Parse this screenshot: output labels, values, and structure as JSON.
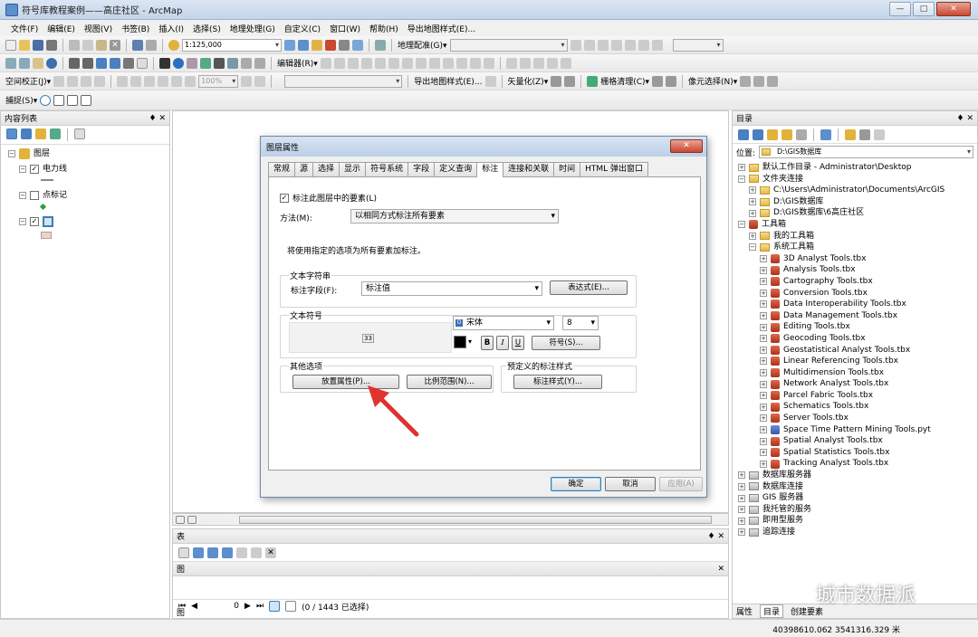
{
  "window": {
    "title": "符号库教程案例——高庄社区 - ArcMap",
    "controls": [
      "—",
      "□",
      "✕"
    ]
  },
  "menu": [
    "文件(F)",
    "编辑(E)",
    "视图(V)",
    "书签(B)",
    "插入(I)",
    "选择(S)",
    "地理处理(G)",
    "自定义(C)",
    "窗口(W)",
    "帮助(H)",
    "导出地图样式(E)..."
  ],
  "toolbar1": {
    "scale": "1:125,000",
    "georef_label": "地理配准(G)▾"
  },
  "toolbar2": {
    "editor": "编辑器(R)▾"
  },
  "toolbar3": {
    "spatial_adjust": "空间校正(J)▾",
    "zoom": "100%",
    "export": "导出地图样式(E)...",
    "vectorize": "矢量化(Z)▾",
    "raster_cleanup": "栅格清理(C)▾",
    "cell_select": "像元选择(N)▾"
  },
  "snapping": {
    "label": "捕捉(S)▾"
  },
  "toc": {
    "title": "内容列表",
    "title_buttons": "♦ ✕",
    "layers_label": "图层",
    "items": [
      {
        "label": "电力线",
        "checked": true
      },
      {
        "label": "点标记",
        "checked": false
      },
      {
        "label": "",
        "checked": true
      }
    ]
  },
  "catalog": {
    "title": "目录",
    "title_buttons": "♦ ✕",
    "location_label": "位置:",
    "location_value": "D:\\GIS数据库",
    "tree": [
      {
        "label": "默认工作目录 - Administrator\\Desktop",
        "level": 0,
        "type": "folder"
      },
      {
        "label": "文件夹连接",
        "level": 0,
        "type": "folder",
        "expanded": true
      },
      {
        "label": "C:\\Users\\Administrator\\Documents\\ArcGIS",
        "level": 1,
        "type": "folder"
      },
      {
        "label": "D:\\GIS数据库",
        "level": 1,
        "type": "folder"
      },
      {
        "label": "D:\\GIS数据库\\6高庄社区",
        "level": 1,
        "type": "folder"
      },
      {
        "label": "工具箱",
        "level": 0,
        "type": "tbx",
        "expanded": true
      },
      {
        "label": "我的工具箱",
        "level": 1,
        "type": "folder"
      },
      {
        "label": "系统工具箱",
        "level": 1,
        "type": "folder",
        "expanded": true
      },
      {
        "label": "3D Analyst Tools.tbx",
        "level": 2,
        "type": "tbx"
      },
      {
        "label": "Analysis Tools.tbx",
        "level": 2,
        "type": "tbx"
      },
      {
        "label": "Cartography Tools.tbx",
        "level": 2,
        "type": "tbx"
      },
      {
        "label": "Conversion Tools.tbx",
        "level": 2,
        "type": "tbx"
      },
      {
        "label": "Data Interoperability Tools.tbx",
        "level": 2,
        "type": "tbx"
      },
      {
        "label": "Data Management Tools.tbx",
        "level": 2,
        "type": "tbx"
      },
      {
        "label": "Editing Tools.tbx",
        "level": 2,
        "type": "tbx"
      },
      {
        "label": "Geocoding Tools.tbx",
        "level": 2,
        "type": "tbx"
      },
      {
        "label": "Geostatistical Analyst Tools.tbx",
        "level": 2,
        "type": "tbx"
      },
      {
        "label": "Linear Referencing Tools.tbx",
        "level": 2,
        "type": "tbx"
      },
      {
        "label": "Multidimension Tools.tbx",
        "level": 2,
        "type": "tbx"
      },
      {
        "label": "Network Analyst Tools.tbx",
        "level": 2,
        "type": "tbx"
      },
      {
        "label": "Parcel Fabric Tools.tbx",
        "level": 2,
        "type": "tbx"
      },
      {
        "label": "Schematics Tools.tbx",
        "level": 2,
        "type": "tbx"
      },
      {
        "label": "Server Tools.tbx",
        "level": 2,
        "type": "tbx"
      },
      {
        "label": "Space Time Pattern Mining Tools.pyt",
        "level": 2,
        "type": "pyt"
      },
      {
        "label": "Spatial Analyst Tools.tbx",
        "level": 2,
        "type": "tbx"
      },
      {
        "label": "Spatial Statistics Tools.tbx",
        "level": 2,
        "type": "tbx"
      },
      {
        "label": "Tracking Analyst Tools.tbx",
        "level": 2,
        "type": "tbx"
      },
      {
        "label": "数据库服务器",
        "level": 0,
        "type": "server"
      },
      {
        "label": "数据库连接",
        "level": 0,
        "type": "server"
      },
      {
        "label": "GIS 服务器",
        "level": 0,
        "type": "server"
      },
      {
        "label": "我托管的服务",
        "level": 0,
        "type": "server"
      },
      {
        "label": "即用型服务",
        "level": 0,
        "type": "server"
      },
      {
        "label": "追踪连接",
        "level": 0,
        "type": "server"
      }
    ],
    "bottom_tabs": [
      "属性",
      "目录",
      "创建要素"
    ]
  },
  "table": {
    "title": "表",
    "title_buttons": "♦ ✕",
    "subtitle": "图",
    "subtitle_buttons": "✕",
    "record": "0",
    "selection_text": "(0 / 1443 已选择)",
    "tab": "图"
  },
  "dialog": {
    "title": "图层属性",
    "close": "✕",
    "tabs": [
      "常规",
      "源",
      "选择",
      "显示",
      "符号系统",
      "字段",
      "定义查询",
      "标注",
      "连接和关联",
      "时间",
      "HTML 弹出窗口"
    ],
    "active_tab": "标注",
    "label_features_check": "标注此图层中的要素(L)",
    "method_label": "方法(M):",
    "method_value": "以相同方式标注所有要素",
    "info_text": "将使用指定的选项为所有要素加标注。",
    "text_string_group": "文本字符串",
    "label_field_label": "标注字段(F):",
    "label_field_value": "标注值",
    "expression_btn": "表达式(E)...",
    "text_symbol_group": "文本符号",
    "font": "宋体",
    "size": "8",
    "bold": "B",
    "italic": "I",
    "underline": "U",
    "symbol_btn": "符号(S)...",
    "other_options_group": "其他选项",
    "placement_btn": "放置属性(P)...",
    "scale_range_btn": "比例范围(N)...",
    "predefined_group": "预定义的标注样式",
    "label_styles_btn": "标注样式(Y)...",
    "ok": "确定",
    "cancel": "取消",
    "apply": "应用(A)"
  },
  "statusbar": {
    "coords": "40398610.062   3541316.329 米"
  },
  "watermark": "城市数据派",
  "colors": {
    "arrow": "#e0332e",
    "title_bar": "#c4d5ea",
    "accent": "#3c7fb1"
  }
}
